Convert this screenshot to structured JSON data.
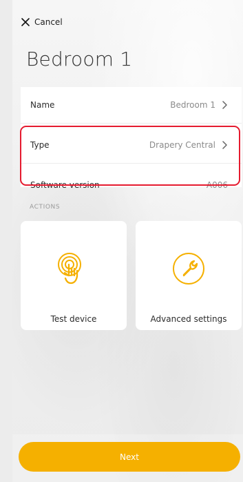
{
  "header": {
    "cancel_label": "Cancel",
    "title": "Bedroom 1"
  },
  "info": {
    "rows": [
      {
        "label": "Name",
        "value": "Bedroom 1",
        "has_chevron": true
      },
      {
        "label": "Type",
        "value": "Drapery Central",
        "has_chevron": true
      },
      {
        "label": "Software version",
        "value": "A006",
        "has_chevron": false
      }
    ]
  },
  "actions": {
    "section_title": "ACTIONS",
    "items": [
      {
        "label": "Test device",
        "icon": "touch-icon"
      },
      {
        "label": "Advanced settings",
        "icon": "wrench-icon"
      }
    ]
  },
  "footer": {
    "next_label": "Next"
  },
  "colors": {
    "accent": "#f5b000",
    "highlight": "#e51b2f"
  }
}
